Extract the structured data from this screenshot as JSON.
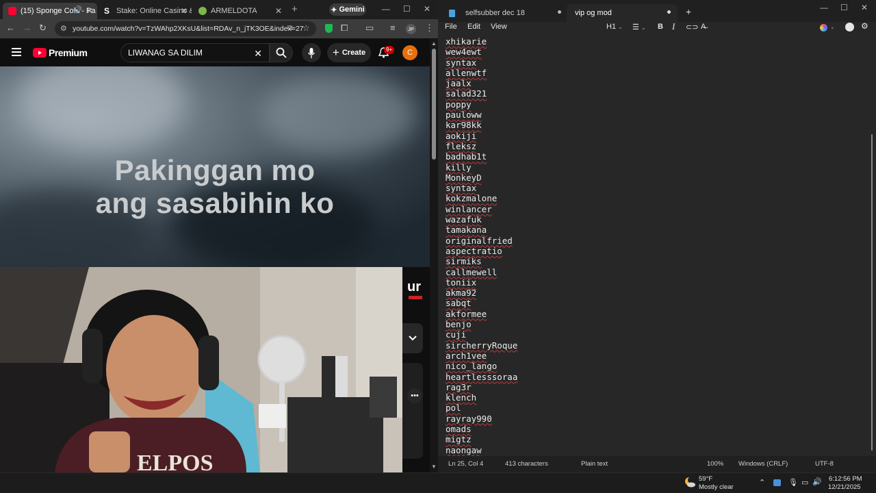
{
  "browser": {
    "tabs": [
      {
        "label": "(15) Sponge Cola - Pa",
        "color": "#ff0033",
        "active": true
      },
      {
        "label": "Stake: Online Casino & Sp",
        "color": "#ffffff",
        "active": false
      },
      {
        "label": "ARMELDOTA",
        "color": "#7bb84a",
        "active": false
      }
    ],
    "gemini_label": "Gemini",
    "url": "youtube.com/watch?v=TzWAhp2XKsU&list=RDAv_n_jTK3OE&index=27",
    "profile_initials": "JP"
  },
  "youtube": {
    "logo_text": "Premium",
    "search_value": "LIWANAG SA DILIM",
    "create_label": "Create",
    "notification_badge": "9+",
    "avatar_letter": "C",
    "video_lyric_line1": "Pakinggan mo",
    "video_lyric_line2": "ang sasabihin ko",
    "brand_watermark": "ur"
  },
  "notepad": {
    "tabs": [
      {
        "label": "selfsubber dec 18",
        "active": false
      },
      {
        "label": "vip og mod",
        "active": true
      }
    ],
    "menu": [
      "File",
      "Edit",
      "View"
    ],
    "heading_select": "H1",
    "lines": [
      "xhikarie",
      "wew4ewt",
      "syntax",
      "allenwtf",
      "jaalx",
      "salad321",
      "poppy",
      "pauloww",
      "kar98kk",
      "aokiji",
      "fleksz",
      "badhab1t",
      "killy",
      "MonkeyD",
      "syntax",
      "kokzmalone",
      "winlancer",
      "wazafuk",
      "tamakana",
      "originalfried",
      "aspectratio",
      "sirmiks",
      "callmewell",
      "toniix",
      "akma92",
      "sabqt",
      "akformee",
      "benjo",
      "cuji",
      "sircherryRoque",
      "arch1vee",
      "nico_lango",
      "heartlesssoraa",
      "rag3r",
      "klench",
      "pol",
      "rayray990",
      "omads",
      "migtz",
      "naongaw"
    ],
    "status": {
      "position": "Ln 25, Col 4",
      "characters": "413 characters",
      "format": "Plain text",
      "zoom": "100%",
      "line_ending": "Windows (CRLF)",
      "encoding": "UTF-8"
    }
  },
  "taskbar": {
    "weather_temp": "59°F",
    "weather_desc": "Mostly clear",
    "time": "6:12:56 PM",
    "date": "12/21/2025"
  }
}
